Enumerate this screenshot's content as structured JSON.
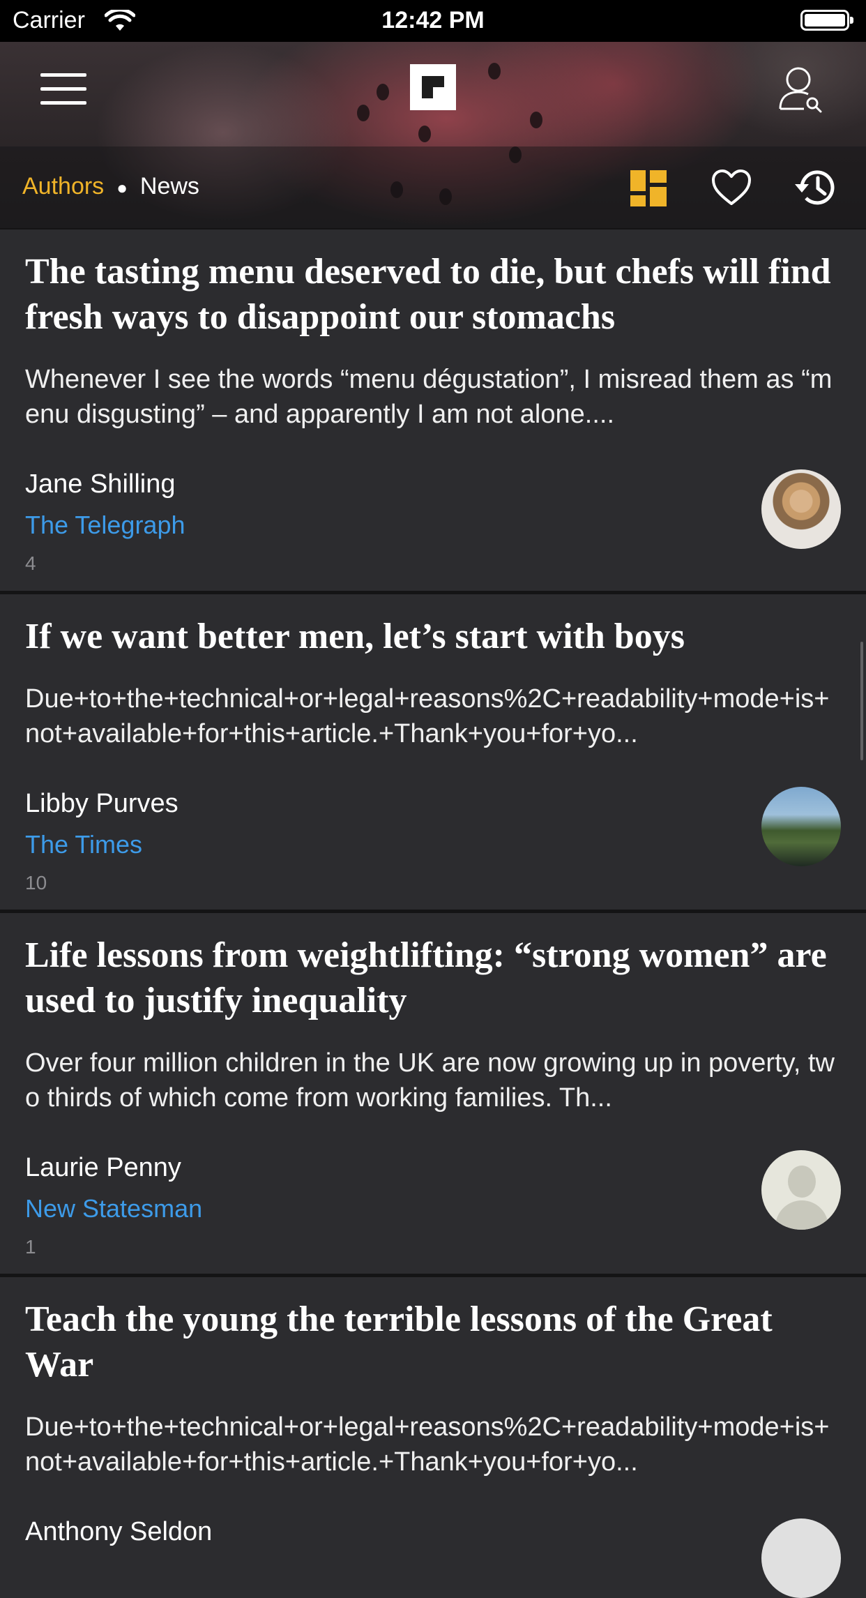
{
  "status_bar": {
    "carrier": "Carrier",
    "time": "12:42 PM"
  },
  "header": {
    "crumb_primary": "Authors",
    "crumb_separator": "●",
    "crumb_secondary": "News"
  },
  "colors": {
    "accent": "#f0b429",
    "link": "#3d9be9",
    "background": "#2c2c2f"
  },
  "articles": [
    {
      "title": "The tasting menu deserved to die, but chefs will find fresh ways to disappoint our stomachs",
      "excerpt": "Whenever I see the words “menu dégustation”, I misread them as “menu disgusting” – and apparently I am not alone....",
      "author": "Jane Shilling",
      "source": "The Telegraph",
      "count": "4"
    },
    {
      "title": "If we want better men, let’s start with boys",
      "excerpt": "Due+to+the+technical+or+legal+reasons%2C+readability+mode+is+not+available+for+this+article.+Thank+you+for+yo...",
      "author": "Libby Purves",
      "source": "The Times",
      "count": "10"
    },
    {
      "title": "Life lessons from weightlifting: “strong women” are used to justify inequality",
      "excerpt": "Over four million children in the UK are now growing up in poverty, two thirds of which come from working families. Th...",
      "author": "Laurie Penny",
      "source": "New Statesman",
      "count": "1"
    },
    {
      "title": "Teach the young the terrible lessons of the Great War",
      "excerpt": "Due+to+the+technical+or+legal+reasons%2C+readability+mode+is+not+available+for+this+article.+Thank+you+for+yo...",
      "author": "Anthony Seldon",
      "source": "",
      "count": ""
    }
  ]
}
